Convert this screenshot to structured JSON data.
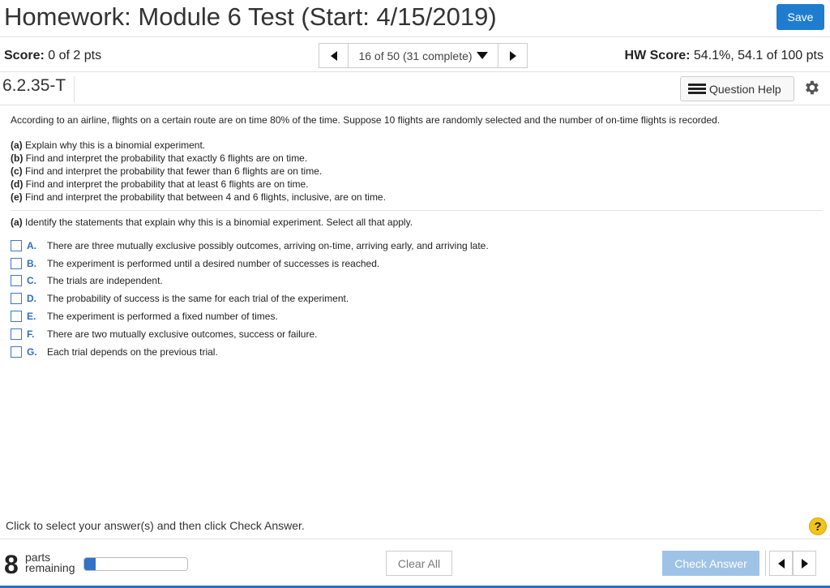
{
  "header": {
    "title": "Homework: Module 6 Test (Start: 4/15/2019)",
    "save_label": "Save"
  },
  "scorebar": {
    "score_label": "Score:",
    "score_value": "0 of 2 pts",
    "question_position": "16 of 50 (31 complete)",
    "hw_score_label": "HW Score:",
    "hw_score_value": "54.1%, 54.1 of 100 pts"
  },
  "question": {
    "id": "6.2.35-T",
    "help_label": "Question Help",
    "intro": "According to an airline, flights on a certain route are on time 80% of the time. Suppose 10 flights are randomly selected and the number of on-time flights is recorded.",
    "parts": [
      {
        "tag": "(a)",
        "text": "Explain why this is a binomial experiment."
      },
      {
        "tag": "(b)",
        "text": "Find and interpret the probability that exactly 6 flights are on time."
      },
      {
        "tag": "(c)",
        "text": "Find and interpret the probability that fewer than 6 flights are on time."
      },
      {
        "tag": "(d)",
        "text": "Find and interpret the probability that at least 6 flights are on time."
      },
      {
        "tag": "(e)",
        "text": "Find and interpret the probability that between 4 and 6 flights, inclusive, are on time."
      }
    ],
    "prompt_tag": "(a)",
    "prompt_text": "Identify the statements that explain why this is a binomial experiment. Select all that apply.",
    "options": [
      {
        "letter": "A.",
        "text": "There are three mutually exclusive possibly outcomes, arriving on-time, arriving early, and arriving late."
      },
      {
        "letter": "B.",
        "text": "The experiment is performed until a desired number of successes is reached."
      },
      {
        "letter": "C.",
        "text": "The trials are independent."
      },
      {
        "letter": "D.",
        "text": "The probability of success is the same for each trial of the experiment."
      },
      {
        "letter": "E.",
        "text": "The experiment is performed a fixed number of times."
      },
      {
        "letter": "F.",
        "text": "There are two mutually exclusive outcomes, success or failure."
      },
      {
        "letter": "G.",
        "text": "Each trial depends on the previous trial."
      }
    ]
  },
  "footer": {
    "instruction": "Click to select your answer(s) and then click Check Answer.",
    "help_symbol": "?",
    "parts_count": "8",
    "parts_label_1": "parts",
    "parts_label_2": "remaining",
    "progress_fraction": 0.11,
    "clear_all_label": "Clear All",
    "check_answer_label": "Check Answer"
  },
  "colors": {
    "accent": "#1f7dd0",
    "option_letter": "#2e6fc0",
    "check_button_disabled": "#9fc3e6",
    "help_badge": "#f3c31b"
  },
  "icons": [
    "chevron-left-icon",
    "chevron-right-icon",
    "dropdown-arrow-icon",
    "list-icon",
    "gear-icon",
    "help-icon"
  ]
}
